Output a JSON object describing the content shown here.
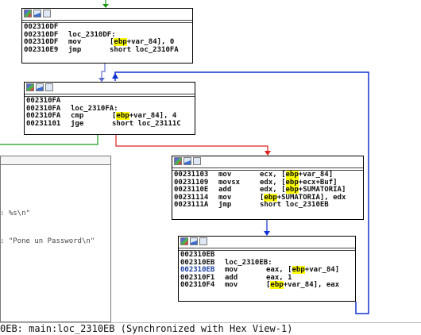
{
  "block1": {
    "lines": [
      {
        "addr": "002310DF",
        "label": "",
        "mnemonic": "",
        "operands": ""
      },
      {
        "addr": "002310DF",
        "label": "loc_2310DF:",
        "mnemonic": "",
        "operands": ""
      },
      {
        "addr": "002310DF",
        "label": "",
        "mnemonic": "mov",
        "operands_pre": "[",
        "operands_hl": "ebp",
        "operands_post": "+var_84], 0"
      },
      {
        "addr": "002310E9",
        "label": "",
        "mnemonic": "jmp",
        "operands": "short loc_2310FA"
      }
    ]
  },
  "block2": {
    "lines": [
      {
        "addr": "002310FA",
        "label": "",
        "mnemonic": "",
        "operands": ""
      },
      {
        "addr": "002310FA",
        "label": "loc_2310FA:",
        "mnemonic": "",
        "operands": ""
      },
      {
        "addr": "002310FA",
        "label": "",
        "mnemonic": "cmp",
        "operands_pre": "[",
        "operands_hl": "ebp",
        "operands_post": "+var_84], 4"
      },
      {
        "addr": "00231101",
        "label": "",
        "mnemonic": "jge",
        "operands": "short loc_23111C"
      }
    ]
  },
  "block3": {
    "lines": [
      {
        "addr": "00231103",
        "mnemonic": "mov",
        "operands_pre": "ecx, [",
        "operands_hl": "ebp",
        "operands_post": "+var_84]"
      },
      {
        "addr": "00231109",
        "mnemonic": "movsx",
        "operands_pre": "edx, [",
        "operands_hl": "ebp",
        "operands_post": "+ecx+Buf]"
      },
      {
        "addr": "0023110E",
        "mnemonic": "add",
        "operands_pre": "edx, [",
        "operands_hl": "ebp",
        "operands_post": "+SUMATORIA]"
      },
      {
        "addr": "00231114",
        "mnemonic": "mov",
        "operands_pre": "[",
        "operands_hl": "ebp",
        "operands_post": "+SUMATORIA], edx"
      },
      {
        "addr": "0023111A",
        "mnemonic": "jmp",
        "operands_pre": "short loc_2310EB",
        "operands_hl": "",
        "operands_post": ""
      }
    ]
  },
  "block4": {
    "lines": [
      {
        "addr": "002310EB",
        "label": "",
        "mnemonic": "",
        "operands": ""
      },
      {
        "addr": "002310EB",
        "label": "loc_2310EB:",
        "mnemonic": "",
        "operands": ""
      },
      {
        "addr": "002310EB",
        "mnemonic": "mov",
        "operands_pre": "eax, [",
        "operands_hl": "ebp",
        "operands_post": "+var_84]",
        "addr_blue": true
      },
      {
        "addr": "002310F1",
        "mnemonic": "add",
        "operands_pre": "eax, 1",
        "operands_hl": "",
        "operands_post": ""
      },
      {
        "addr": "002310F4",
        "mnemonic": "mov",
        "operands_pre": "[",
        "operands_hl": "ebp",
        "operands_post": "+var_84], eax"
      }
    ]
  },
  "left_panel": {
    "line1": ": %s\\n\"",
    "line2": ": \"Pone un Password\\n\""
  },
  "status_bar": {
    "text": "0EB: main:loc_2310EB (Synchronized with Hex View-1)"
  },
  "colors": {
    "highlight": "#ffff00",
    "edge_true": "#1a9a1a",
    "edge_false": "#e02020",
    "edge_uncond": "#1030d0",
    "addr_blue": "#1c3fa0"
  }
}
